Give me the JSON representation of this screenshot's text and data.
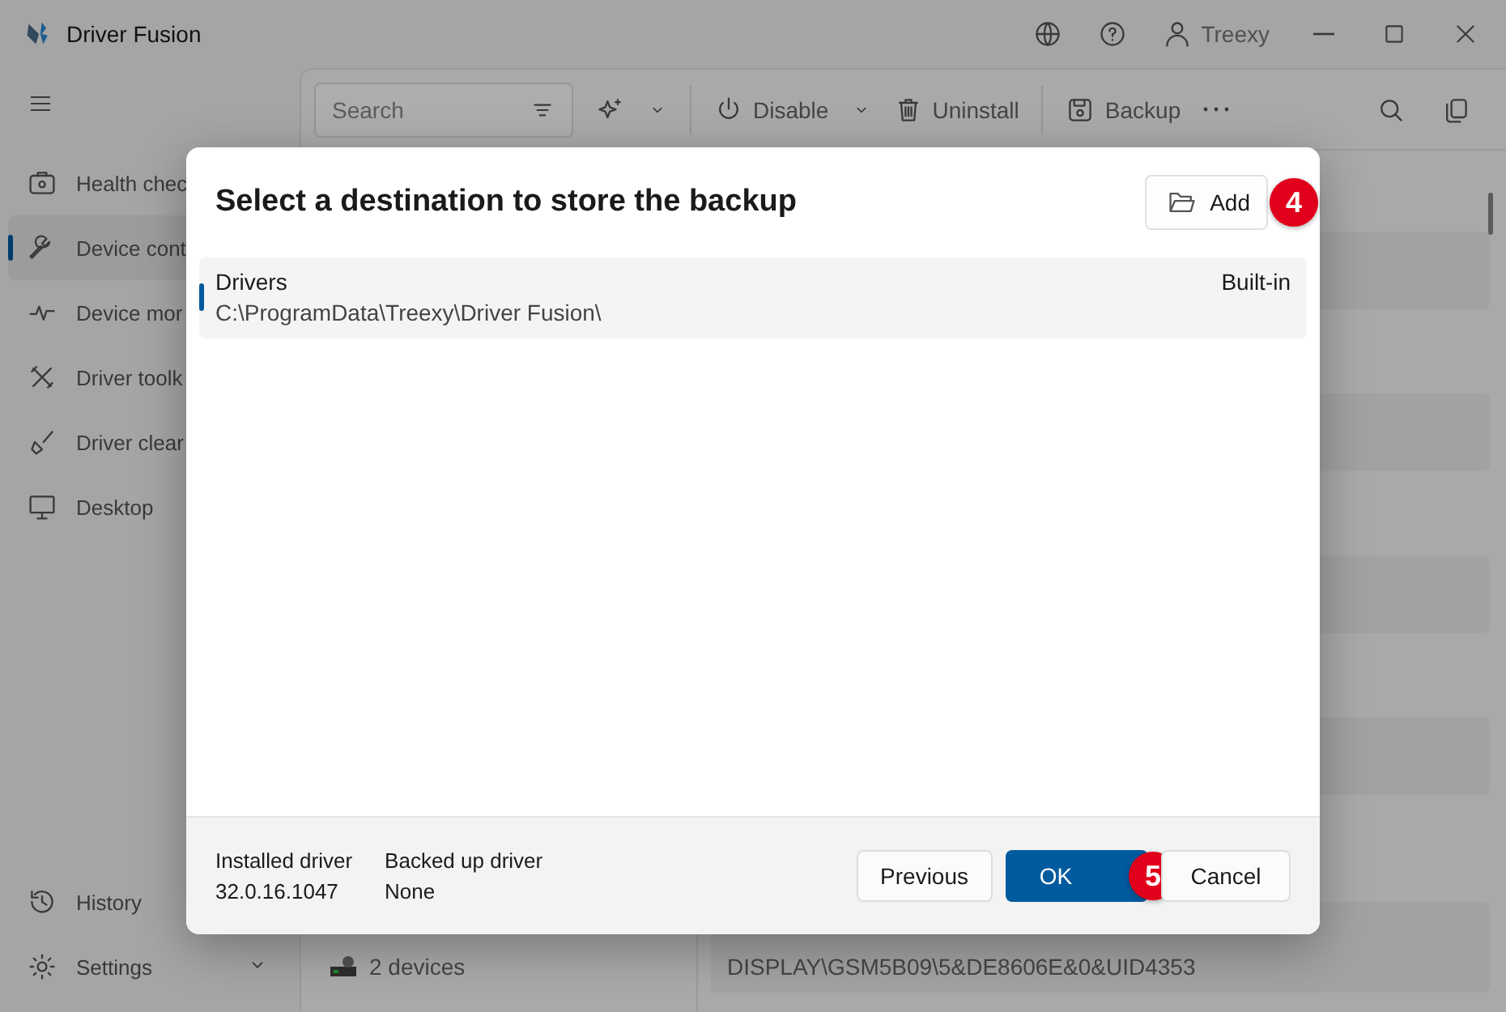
{
  "window": {
    "title": "Driver Fusion",
    "user": "Treexy"
  },
  "sidebar": {
    "items": [
      {
        "label": "Health chec",
        "selected": false
      },
      {
        "label": "Device cont",
        "selected": true
      },
      {
        "label": "Device mor",
        "selected": false
      },
      {
        "label": "Driver toolk",
        "selected": false
      },
      {
        "label": "Driver clear",
        "selected": false
      },
      {
        "label": "Desktop",
        "selected": false
      }
    ],
    "footer_items": [
      {
        "label": "History"
      },
      {
        "label": "Settings",
        "expandable": true
      }
    ]
  },
  "toolbar": {
    "search": {
      "placeholder": "Search"
    },
    "buttons": [
      {
        "label": "Disable",
        "kind": "split"
      },
      {
        "label": "Uninstall",
        "kind": "plain"
      },
      {
        "label": "Backup",
        "kind": "plain"
      }
    ]
  },
  "device_list": [
    {
      "count": "2 devices"
    }
  ],
  "details": {
    "value": "DISPLAY\\GSM5B09\\5&DE8606E&0&UID4353"
  },
  "dialog": {
    "title": "Select a destination to store the backup",
    "add_button": {
      "label": "Add",
      "callout": "4"
    },
    "destinations": [
      {
        "name": "Drivers",
        "path": "C:\\ProgramData\\Treexy\\Driver Fusion\\",
        "type": "Built-in",
        "selected": true
      }
    ],
    "info": [
      {
        "label": "Installed driver",
        "value": "32.0.16.1047"
      },
      {
        "label": "Backed up driver",
        "value": "None"
      }
    ],
    "buttons": [
      {
        "label": "Previous",
        "kind": "secondary"
      },
      {
        "label": "OK",
        "kind": "primary",
        "callout": "5"
      },
      {
        "label": "Cancel",
        "kind": "secondary"
      }
    ]
  }
}
